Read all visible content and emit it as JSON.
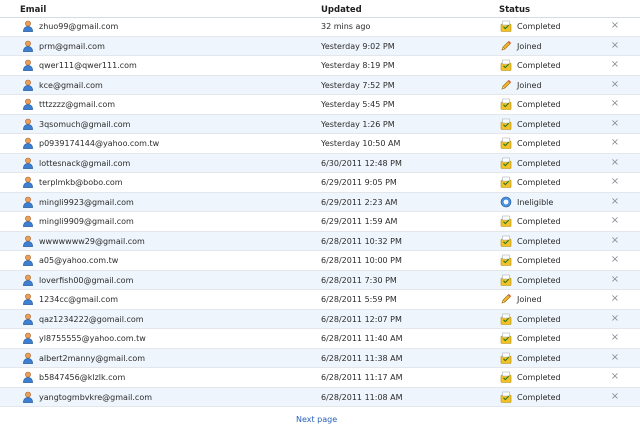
{
  "columns": {
    "email": "Email",
    "updated": "Updated",
    "status": "Status"
  },
  "rows": [
    {
      "email": "zhuo99@gmail.com",
      "updated": "32 mins ago",
      "status": "Completed",
      "icon": "completed-icon"
    },
    {
      "email": "prm@gmail.com",
      "updated": "Yesterday 9:02 PM",
      "status": "Joined",
      "icon": "pencil-icon"
    },
    {
      "email": "qwer111@qwer111.com",
      "updated": "Yesterday 8:19 PM",
      "status": "Completed",
      "icon": "completed-icon"
    },
    {
      "email": "kce@gmail.com",
      "updated": "Yesterday 7:52 PM",
      "status": "Joined",
      "icon": "pencil-icon"
    },
    {
      "email": "tttzzzz@gmail.com",
      "updated": "Yesterday 5:45 PM",
      "status": "Completed",
      "icon": "completed-icon"
    },
    {
      "email": "3qsomuch@gmail.com",
      "updated": "Yesterday 1:26 PM",
      "status": "Completed",
      "icon": "completed-icon"
    },
    {
      "email": "p0939174144@yahoo.com.tw",
      "updated": "Yesterday 10:50 AM",
      "status": "Completed",
      "icon": "completed-icon"
    },
    {
      "email": "lottesnack@gmail.com",
      "updated": "6/30/2011 12:48 PM",
      "status": "Completed",
      "icon": "completed-icon"
    },
    {
      "email": "terplmkb@bobo.com",
      "updated": "6/29/2011 9:05 PM",
      "status": "Completed",
      "icon": "completed-icon"
    },
    {
      "email": "mingli9923@gmail.com",
      "updated": "6/29/2011 2:23 AM",
      "status": "Ineligible",
      "icon": "ineligible-icon"
    },
    {
      "email": "mingli9909@gmail.com",
      "updated": "6/29/2011 1:59 AM",
      "status": "Completed",
      "icon": "completed-icon"
    },
    {
      "email": "wwwwwww29@gmail.com",
      "updated": "6/28/2011 10:32 PM",
      "status": "Completed",
      "icon": "completed-icon"
    },
    {
      "email": "a05@yahoo.com.tw",
      "updated": "6/28/2011 10:00 PM",
      "status": "Completed",
      "icon": "completed-icon"
    },
    {
      "email": "loverfish00@gmail.com",
      "updated": "6/28/2011 7:30 PM",
      "status": "Completed",
      "icon": "completed-icon"
    },
    {
      "email": "1234cc@gmail.com",
      "updated": "6/28/2011 5:59 PM",
      "status": "Joined",
      "icon": "pencil-icon"
    },
    {
      "email": "qaz1234222@gomail.com",
      "updated": "6/28/2011 12:07 PM",
      "status": "Completed",
      "icon": "completed-icon"
    },
    {
      "email": "yl8755555@yahoo.com.tw",
      "updated": "6/28/2011 11:40 AM",
      "status": "Completed",
      "icon": "completed-icon"
    },
    {
      "email": "albert2manny@gmail.com",
      "updated": "6/28/2011 11:38 AM",
      "status": "Completed",
      "icon": "completed-icon"
    },
    {
      "email": "b5847456@klzlk.com",
      "updated": "6/28/2011 11:17 AM",
      "status": "Completed",
      "icon": "completed-icon"
    },
    {
      "email": "yangtogmbvkre@gmail.com",
      "updated": "6/28/2011 11:08 AM",
      "status": "Completed",
      "icon": "completed-icon"
    }
  ],
  "remove_glyph": "×",
  "footer": {
    "next_label": "Next page"
  },
  "colors": {
    "row_alt": "#eef5fc",
    "link": "#2a62b8",
    "completed": "#e8b400",
    "ineligible": "#3b7dd8"
  }
}
